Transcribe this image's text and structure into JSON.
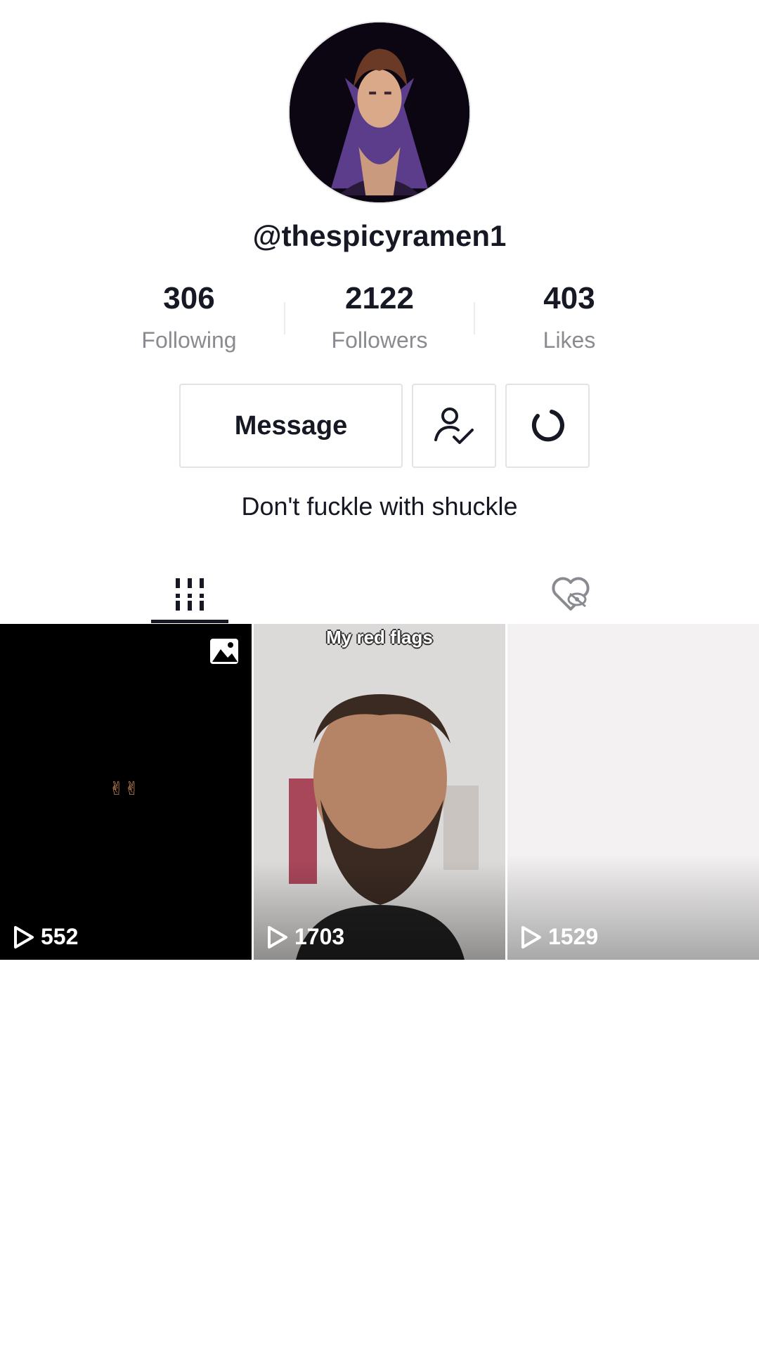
{
  "profile": {
    "username": "@thespicyramen1",
    "bio": "Don't fuckle with shuckle"
  },
  "stats": {
    "following": {
      "value": "306",
      "label": "Following"
    },
    "followers": {
      "value": "2122",
      "label": "Followers"
    },
    "likes": {
      "value": "403",
      "label": "Likes"
    }
  },
  "actions": {
    "message_label": "Message",
    "friends_icon": "user-check-icon",
    "more_icon": "refresh-icon"
  },
  "tabs": [
    {
      "icon": "grid-icon",
      "active": true
    },
    {
      "icon": "liked-hidden-icon",
      "active": false
    }
  ],
  "videos": [
    {
      "views": "552",
      "caption": "",
      "overlay": "✌✌",
      "type": "photo"
    },
    {
      "views": "1703",
      "caption": "My red flags",
      "overlay": "",
      "type": "video"
    },
    {
      "views": "1529",
      "caption": "",
      "overlay": "",
      "type": "video"
    }
  ],
  "colors": {
    "text_primary": "#161823",
    "text_secondary": "#8a8b91",
    "border": "#e3e3e4"
  }
}
